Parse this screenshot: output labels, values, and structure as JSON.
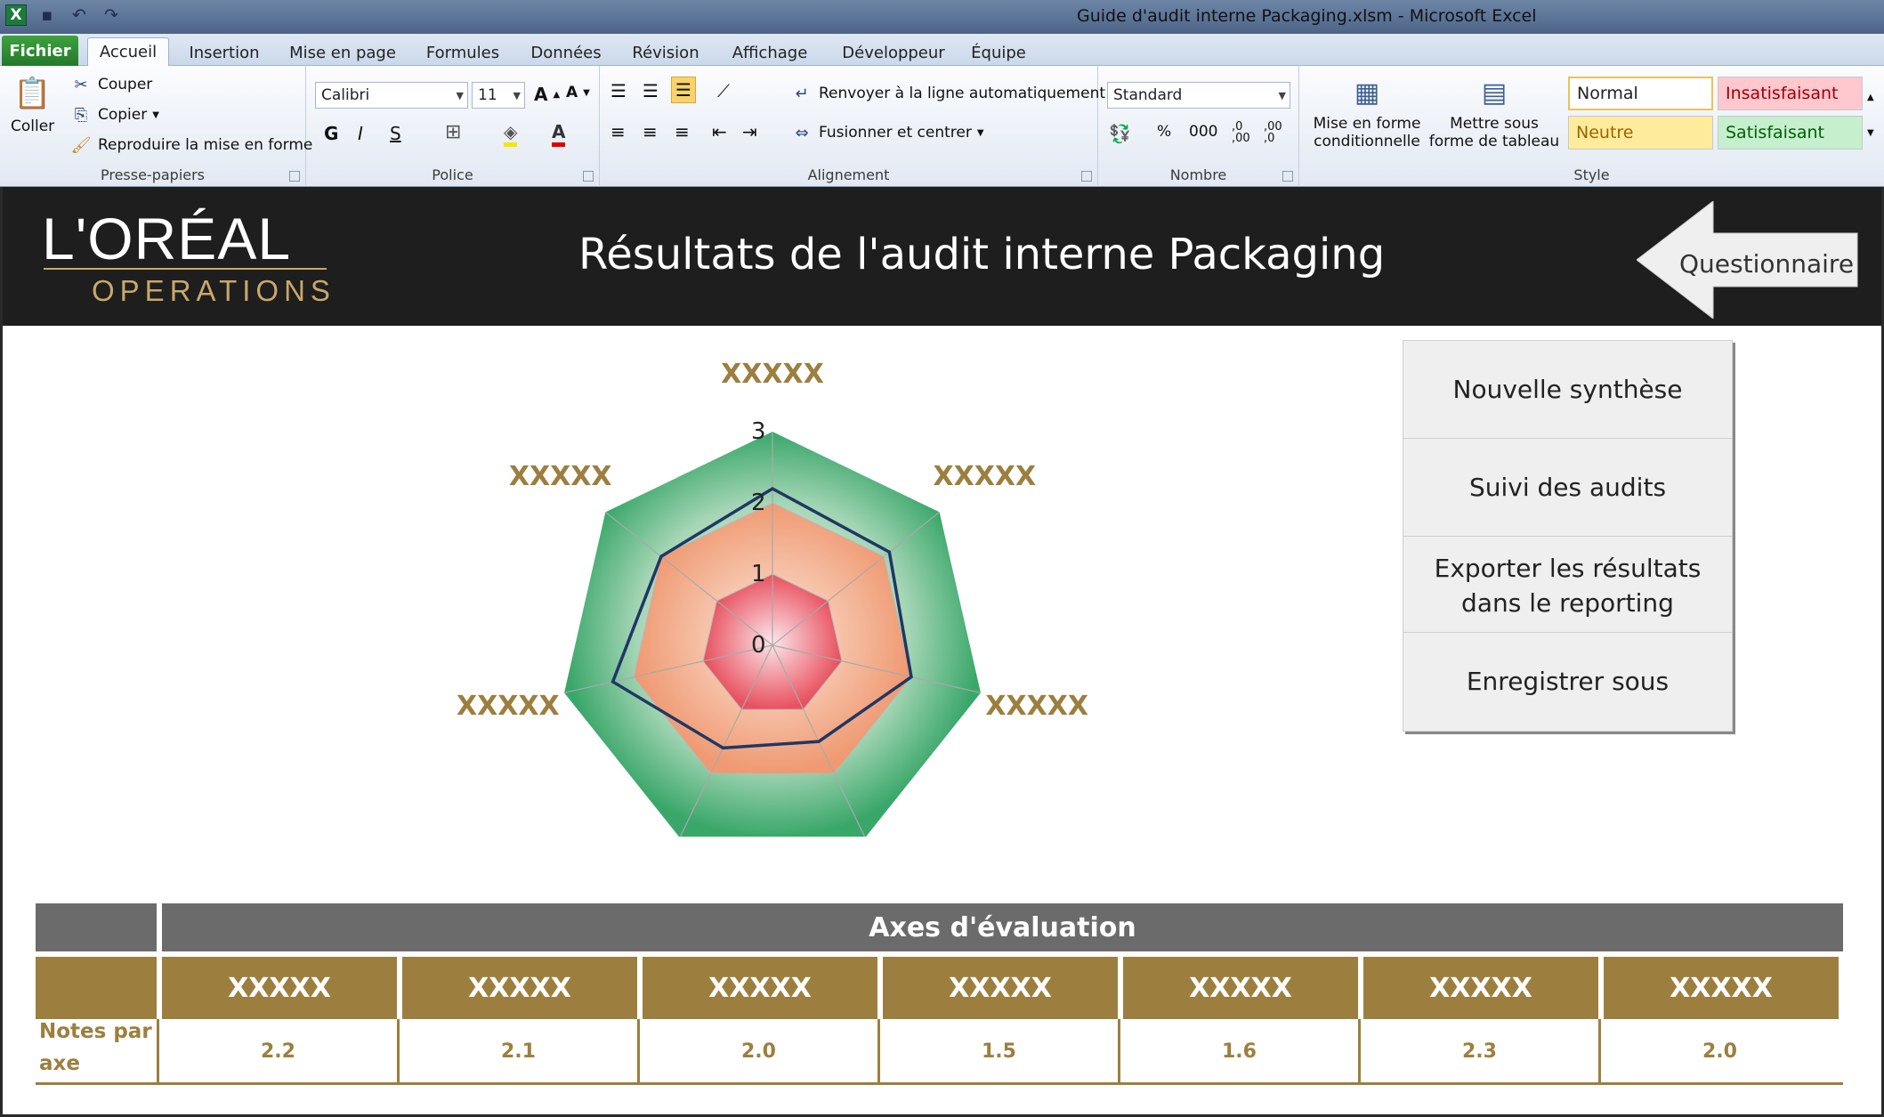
{
  "window": {
    "title": "Guide d'audit interne Packaging.xlsm  -  Microsoft Excel"
  },
  "tabs": [
    "Fichier",
    "Accueil",
    "Insertion",
    "Mise en page",
    "Formules",
    "Données",
    "Révision",
    "Affichage",
    "Développeur",
    "Équipe"
  ],
  "ribbon": {
    "clipboard": {
      "name": "Presse-papiers",
      "paste": "Coller",
      "cut": "Couper",
      "copy": "Copier",
      "format_painter": "Reproduire la mise en forme"
    },
    "font": {
      "name": "Police",
      "family": "Calibri",
      "size": "11",
      "bold": "G",
      "italic": "I",
      "underline": "S"
    },
    "alignment": {
      "name": "Alignement",
      "wrap": "Renvoyer à la ligne automatiquement",
      "merge": "Fusionner et centrer"
    },
    "number": {
      "name": "Nombre",
      "format": "Standard",
      "percent": "%",
      "thousands": "000"
    },
    "styles": {
      "name": "Style",
      "cond_format": "Mise en forme conditionnelle",
      "table_format": "Mettre sous forme de tableau",
      "normal": "Normal",
      "bad": "Insatisfaisant",
      "neutral": "Neutre",
      "good": "Satisfaisant"
    }
  },
  "banner": {
    "logo_main": "L'ORÉAL",
    "logo_sub": "OPERATIONS",
    "title": "Résultats de l'audit interne Packaging",
    "back_button": "Questionnaire"
  },
  "buttons": {
    "new_summary": "Nouvelle synthèse",
    "audit_follow": "Suivi des audits",
    "export": "Exporter les résultats dans le reporting",
    "save_as": "Enregistrer sous"
  },
  "chart_data": {
    "type": "radar",
    "categories": [
      "XXXXX",
      "XXXXX",
      "XXXXX",
      "XXXXX",
      "XXXXX",
      "XXXXX",
      "XXXXX"
    ],
    "tick_labels": [
      "0",
      "1",
      "2",
      "3"
    ],
    "rmax": 3,
    "series": [
      {
        "values": [
          2.2,
          2.1,
          2.0,
          1.5,
          1.6,
          2.3,
          2.0
        ],
        "color": "#1f3864"
      }
    ],
    "bands": [
      {
        "value": 1,
        "color": "#e8515f"
      },
      {
        "value": 2,
        "color": "#ef9a72"
      },
      {
        "value": 3,
        "color": "#3aa76a"
      }
    ]
  },
  "table": {
    "header": "Axes d'évaluation",
    "row_label": "Notes par axe",
    "columns": [
      "XXXXX",
      "XXXXX",
      "XXXXX",
      "XXXXX",
      "XXXXX",
      "XXXXX",
      "XXXXX"
    ],
    "scores": [
      "2.2",
      "2.1",
      "2.0",
      "1.5",
      "1.6",
      "2.3",
      "2.0"
    ]
  }
}
